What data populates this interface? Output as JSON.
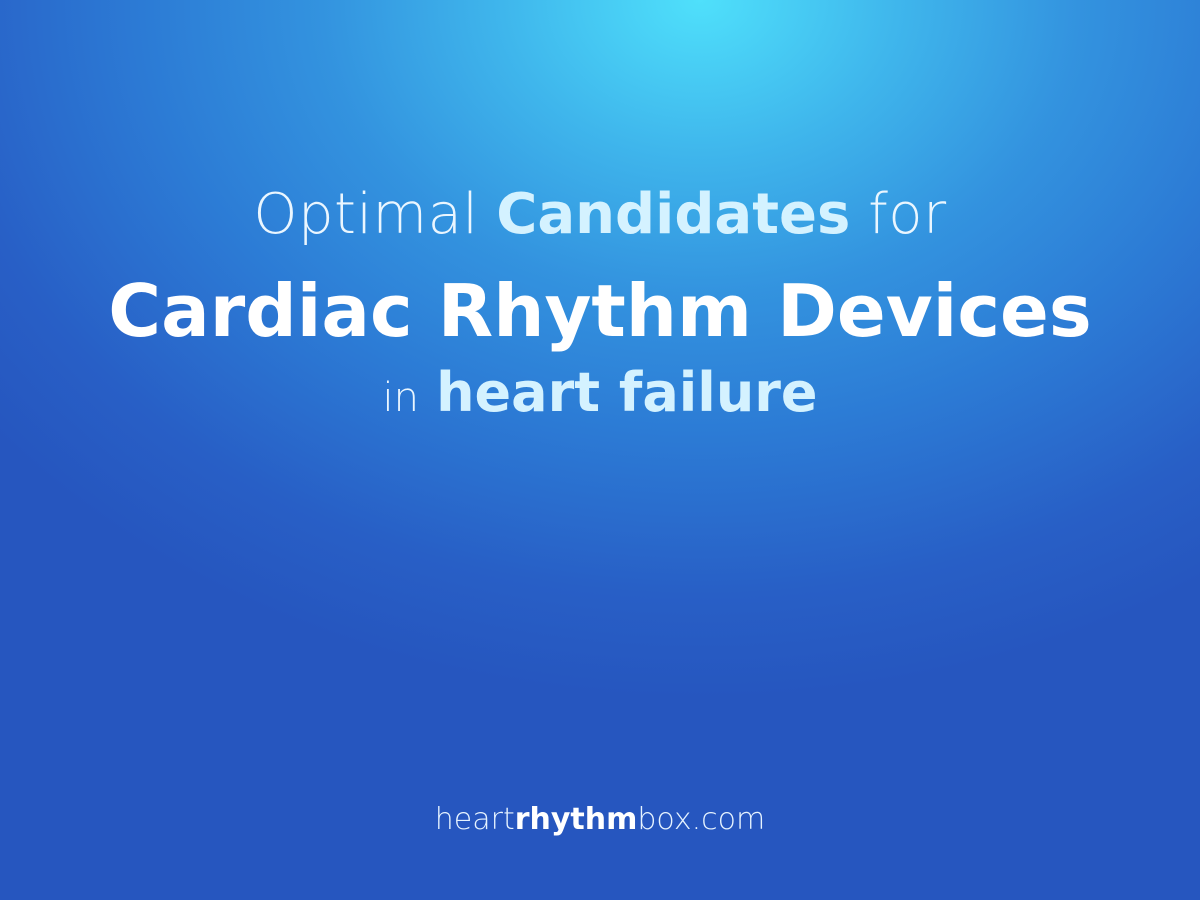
{
  "title": {
    "line1": {
      "part1": "Optimal",
      "part2": "Candidates",
      "part3": "for"
    },
    "line2": "Cardiac Rhythm Devices",
    "line3": {
      "part1": "in",
      "part2": "heart failure"
    }
  },
  "footer": {
    "part1": "heart",
    "part2": "rhythm",
    "part3": "box.com"
  },
  "colors": {
    "background_top": "#4fe0fb",
    "background_bottom": "#2656bf",
    "accent_text": "#d4f2ff"
  }
}
